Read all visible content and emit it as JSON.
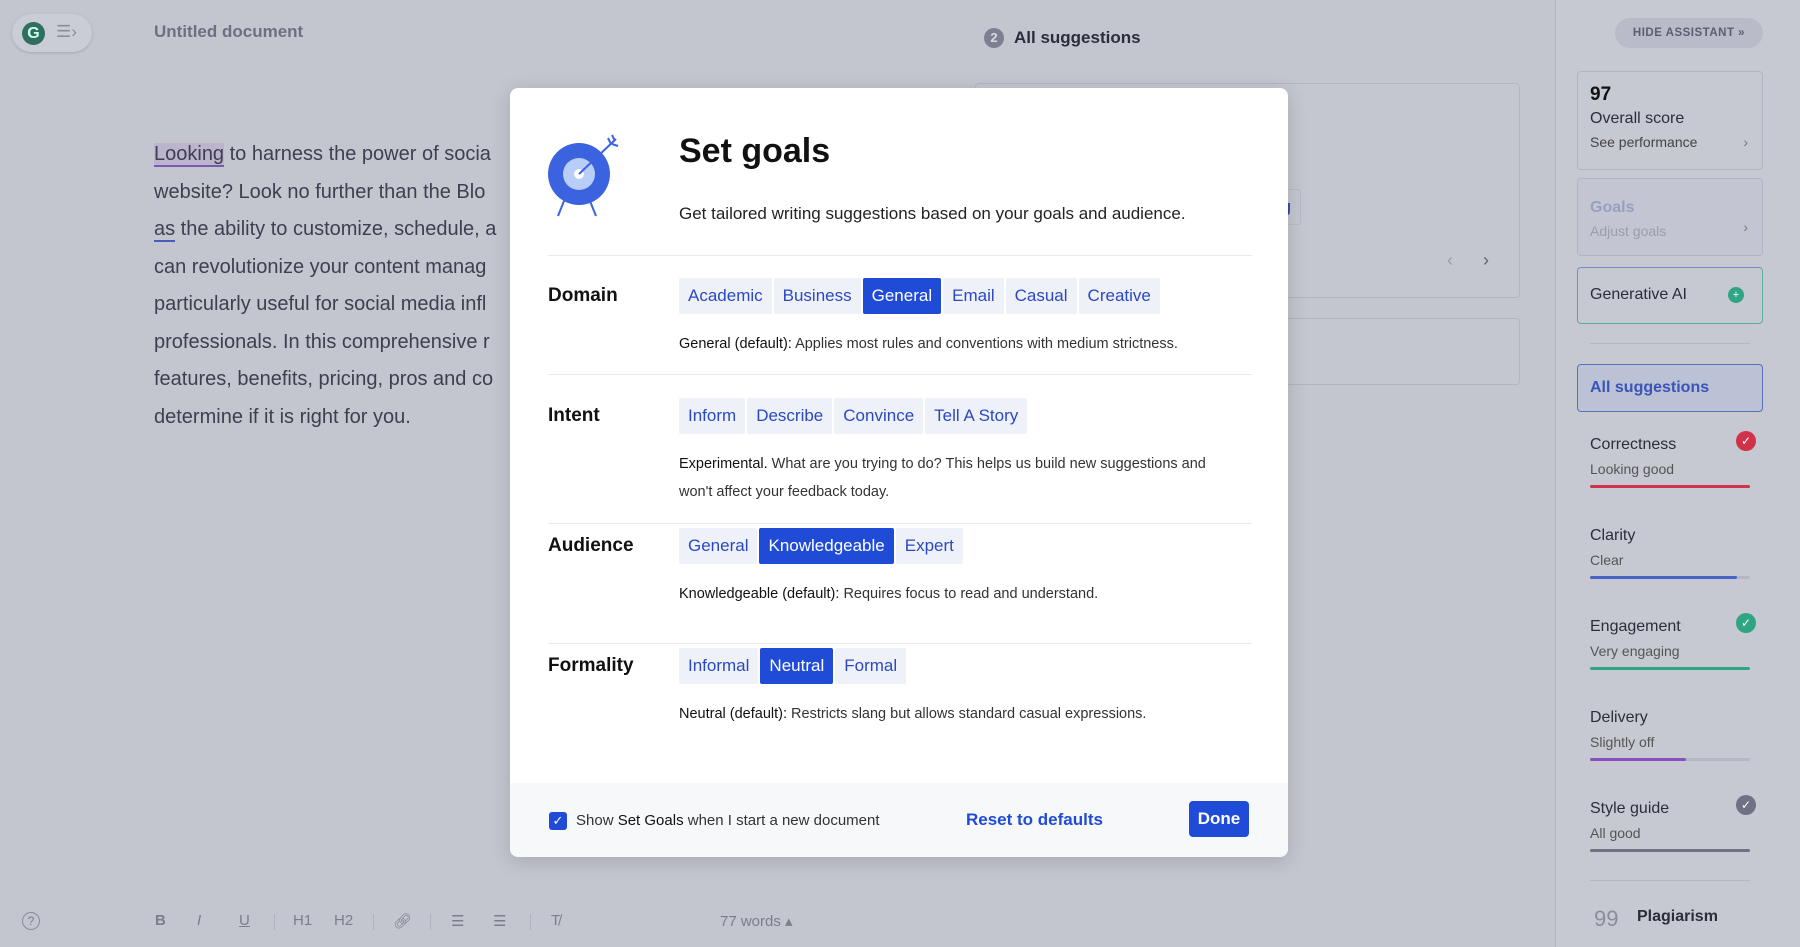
{
  "header": {
    "doc_title": "Untitled document",
    "suggestion_count": "2",
    "all_suggestions": "All suggestions",
    "logo_letter": "G"
  },
  "document": {
    "lines": [
      [
        "Looking",
        " to harness the power of socia"
      ],
      [
        "website? Look no further than the Blo"
      ],
      [
        "as",
        " the ability to customize, schedule, a"
      ],
      [
        "can revolutionize your content manag"
      ],
      [
        "particularly useful for social media infl"
      ],
      [
        "professionals. In this comprehensive r"
      ],
      [
        "features, benefits, pricing, pros and co"
      ],
      [
        "determine if it is right for you."
      ]
    ]
  },
  "background_card": {
    "chip_text": "g"
  },
  "modal": {
    "title": "Set goals",
    "subtitle": "Get tailored writing suggestions based on your goals and audience.",
    "sections": [
      {
        "label": "Domain",
        "options": [
          "Academic",
          "Business",
          "General",
          "Email",
          "Casual",
          "Creative"
        ],
        "selected": "General",
        "desc_bold": "General (default):",
        "desc": " Applies most rules and conventions with medium strictness."
      },
      {
        "label": "Intent",
        "options": [
          "Inform",
          "Describe",
          "Convince",
          "Tell A Story"
        ],
        "selected": null,
        "desc_bold": "Experimental.",
        "desc": " What are you trying to do? This helps us build new suggestions and won't affect your feedback today."
      },
      {
        "label": "Audience",
        "options": [
          "General",
          "Knowledgeable",
          "Expert"
        ],
        "selected": "Knowledgeable",
        "desc_bold": "Knowledgeable (default):",
        "desc": " Requires focus to read and understand."
      },
      {
        "label": "Formality",
        "options": [
          "Informal",
          "Neutral",
          "Formal"
        ],
        "selected": "Neutral",
        "desc_bold": "Neutral (default):",
        "desc": " Restricts slang but allows standard casual expressions."
      }
    ],
    "footer": {
      "checkbox_checked": true,
      "checkbox_pre": "Show ",
      "checkbox_bold": "Set Goals",
      "checkbox_post": " when I start a new document",
      "reset": "Reset to defaults",
      "done": "Done"
    }
  },
  "sidebar": {
    "hide": "HIDE ASSISTANT »",
    "score": "97",
    "score_label": "Overall score",
    "score_link": "See performance",
    "goals": "Goals",
    "goals_link": "Adjust goals",
    "genai": "Generative AI",
    "all": "All suggestions",
    "items": [
      {
        "title": "Correctness",
        "status": "Looking good",
        "color": "#d0324a",
        "fill": 1.0,
        "check": true
      },
      {
        "title": "Clarity",
        "status": "Clear",
        "color": "#4a62c8",
        "fill": 0.92,
        "check": false
      },
      {
        "title": "Engagement",
        "status": "Very engaging",
        "color": "#2fa584",
        "fill": 1.0,
        "check": true
      },
      {
        "title": "Delivery",
        "status": "Slightly off",
        "color": "#8a4fc0",
        "fill": 0.6,
        "check": false
      },
      {
        "title": "Style guide",
        "status": "All good",
        "color": "#6f7284",
        "fill": 1.0,
        "check": true
      }
    ],
    "plagiarism": "Plagiarism"
  },
  "toolbar": {
    "word_count": "77 words ▴",
    "buttons": [
      "B",
      "I",
      "U",
      "H1",
      "H2"
    ]
  }
}
